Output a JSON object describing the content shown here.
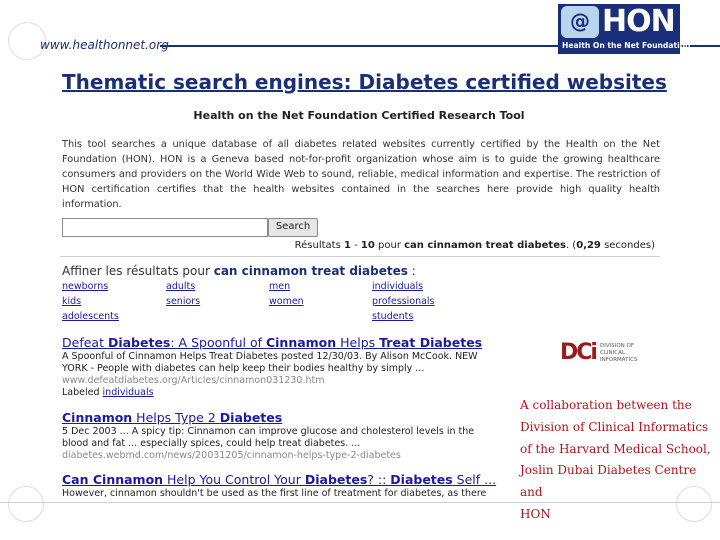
{
  "header": {
    "url": "www.healthonnet.org",
    "logo": {
      "glyph": "@",
      "name": "HON",
      "subtitle": "Health On the Net Foundation"
    }
  },
  "title": "Thematic search engines: Diabetes certified websites",
  "tool": {
    "title": "Health on the Net Foundation Certified Research Tool",
    "description": "This tool searches a unique database of all diabetes related websites currently certified by the Health on the Net Foundation (HON). HON is a Geneva based not-for-profit organization whose aim is to guide the growing healthcare consumers and providers on the World Wide Web to sound, reliable, medical information and expertise. The restriction of HON certification certifies that the health websites contained in the searches here provide high quality health information.",
    "search": {
      "value": "",
      "button_label": "Search"
    },
    "results_summary": {
      "prefix": "Résultats ",
      "range_start": "1",
      "sep": " - ",
      "range_end": "10",
      "mid": " pour ",
      "query": "can cinnamon treat diabetes",
      "comma": ". (",
      "time": "0,29",
      "suffix": " secondes)"
    },
    "refine": {
      "prefix": "Affiner les résultats pour ",
      "query": "can cinnamon treat diabetes",
      "suffix": " :"
    },
    "refine_tags": [
      "newborns",
      "adults",
      "men",
      "individuals",
      "kids",
      "seniors",
      "women",
      "professionals",
      "adolescents",
      "students"
    ],
    "results": [
      {
        "title_parts": [
          "Defeat ",
          "Diabetes",
          ": A Spoonful of ",
          "Cinnamon",
          " Helps ",
          "Treat Diabetes"
        ],
        "snippet": "A Spoonful of Cinnamon Helps Treat Diabetes posted 12/30/03. By Alison McCook. NEW YORK - People with diabetes can help keep their bodies healthy by simply ...",
        "url": "www.defeatdiabetes.org/Articles/cinnamon031230.htm",
        "label_prefix": "Labeled ",
        "label_link": "individuals"
      },
      {
        "title_parts": [
          "Cinnamon",
          " Helps Type 2 ",
          "Diabetes"
        ],
        "snippet": "5 Dec 2003 ... A spicy tip: Cinnamon can improve glucose and cholesterol levels in the blood and fat ... especially spices, could help treat diabetes. ...",
        "url": "diabetes.webmd.com/news/20031205/cinnamon-helps-type-2-diabetes"
      },
      {
        "title_parts": [
          "Can Cinnamon",
          " Help You Control Your ",
          "Diabetes",
          "? :: ",
          "Diabetes",
          " Self ..."
        ],
        "snippet": "However, cinnamon shouldn't be used as the first line of treatment for diabetes, as there"
      }
    ]
  },
  "dci": {
    "mark": "DCi",
    "line1": "DIVISION OF",
    "line2": "CLINICAL",
    "line3": "INFORMATICS"
  },
  "collaboration": [
    "A collaboration between the",
    "Division of Clinical Informatics",
    "of the Harvard Medical School,",
    "Joslin Dubai Diabetes Centre and",
    "HON"
  ]
}
